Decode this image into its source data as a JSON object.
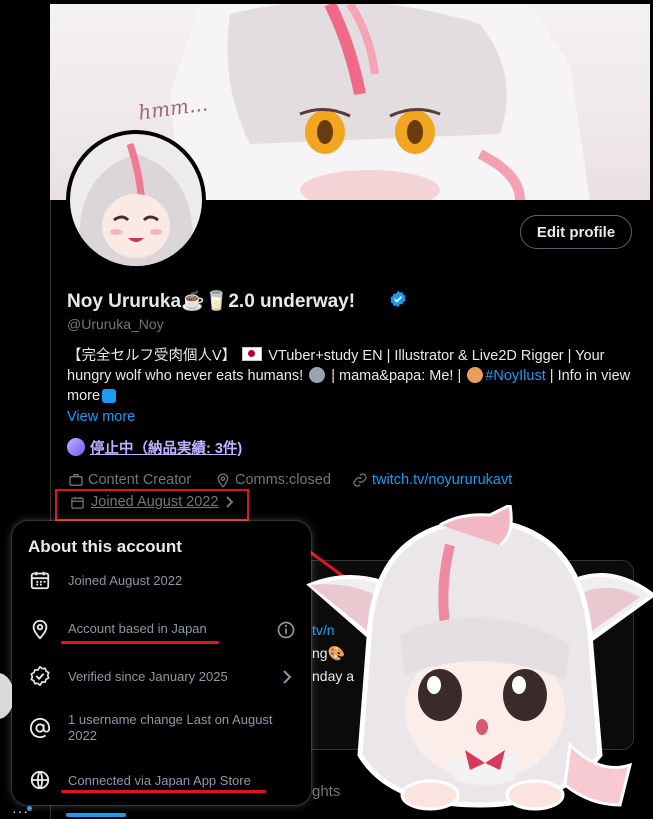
{
  "profile": {
    "display_name": "Noy Ururuka☕🥛2.0 underway!",
    "handle": "@Ururuka_Noy",
    "edit_button": "Edit profile",
    "bio_part1": "【完全セルフ受肉個人V】",
    "bio_part2": "VTuber+study EN | Illustrator & Live2D Rigger | Your hungry wolf who never eats humans!",
    "bio_part3": "| mama&papa: Me! |",
    "bio_hashtag": "#NoyIlust",
    "bio_part4": "| Info in view more",
    "view_more": "View more",
    "commission_status": "停止中（納品実績: 3件)",
    "category": "Content Creator",
    "location": "Comms:closed",
    "website": "twitch.tv/noyururukavt",
    "joined": "Joined August 2022",
    "banner_text": "hmm..."
  },
  "popup": {
    "title": "About this account",
    "rows": [
      {
        "icon": "calendar-icon",
        "text": "Joined August 2022"
      },
      {
        "icon": "location-pin-icon",
        "text": "Account based in Japan"
      },
      {
        "icon": "verified-check-icon",
        "text": "Verified since January 2025"
      },
      {
        "icon": "at-sign-icon",
        "text": "1 username change Last on August 2022"
      },
      {
        "icon": "globe-icon",
        "text": "Connected via Japan App Store"
      }
    ]
  },
  "background": {
    "link_fragment": "tv/n",
    "text_fragment": "ng🎨",
    "text_fragment2": "nday a",
    "tab_fragment": "ghts"
  },
  "colors": {
    "accent": "#1d9bf0",
    "annotation_red": "#e0141e",
    "status_purple": "#c4b0ff"
  }
}
